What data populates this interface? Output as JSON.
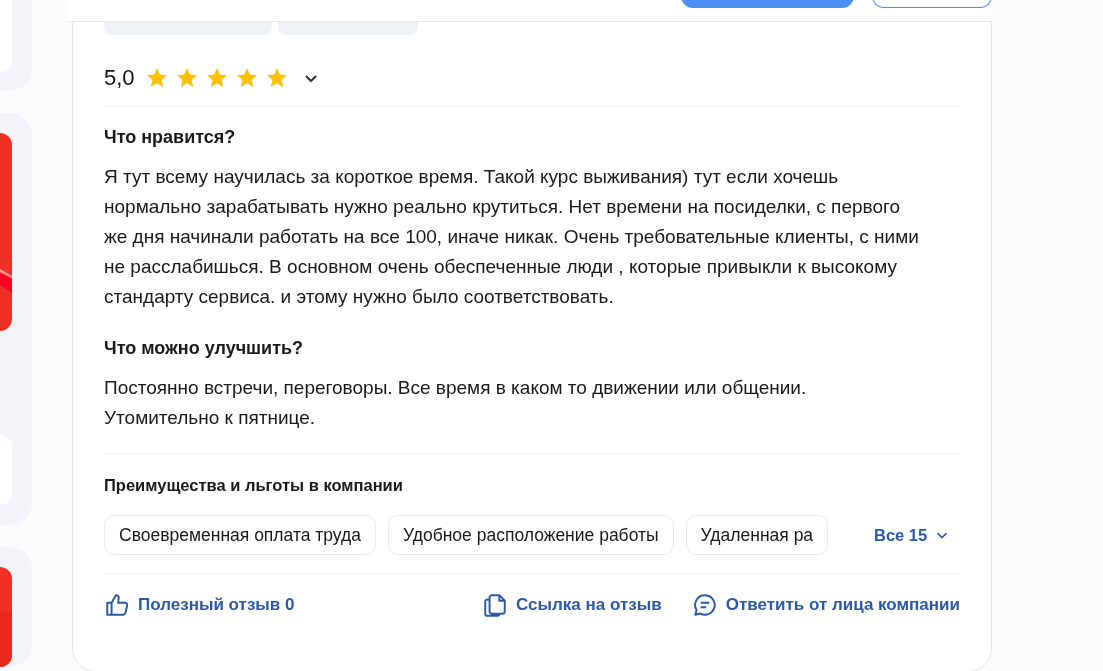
{
  "review": {
    "rating": "5,0",
    "stars": 5,
    "sections": [
      {
        "heading": "Что нравится?",
        "text": "Я тут всему научилась за короткое время. Такой курс выживания) тут если хочешь нормально зарабатывать нужно реально крутиться. Нет времени на посиделки, с первого же дня начинали работать на все 100, иначе никак. Очень требовательные клиенты, с ними не расслабишься. В основном очень обеспеченные люди , которые привыкли к высокому стандарту сервиса. и этому нужно было соответствовать."
      },
      {
        "heading": "Что можно улучшить?",
        "text": "Постоянно встречи, переговоры. Все время в каком то движении или общении. Утомительно к пятнице."
      }
    ],
    "benefits": {
      "title": "Преимущества и льготы в компании",
      "items": [
        "Своевременная оплата труда",
        "Удобное расположение работы",
        "Удаленная ра"
      ],
      "more": "Все 15"
    },
    "actions": [
      {
        "kind": "like",
        "label": "Полезный отзыв 0"
      },
      {
        "kind": "link",
        "label": "Ссылка на отзыв"
      },
      {
        "kind": "reply",
        "label": "Ответить от лица компании"
      }
    ]
  }
}
